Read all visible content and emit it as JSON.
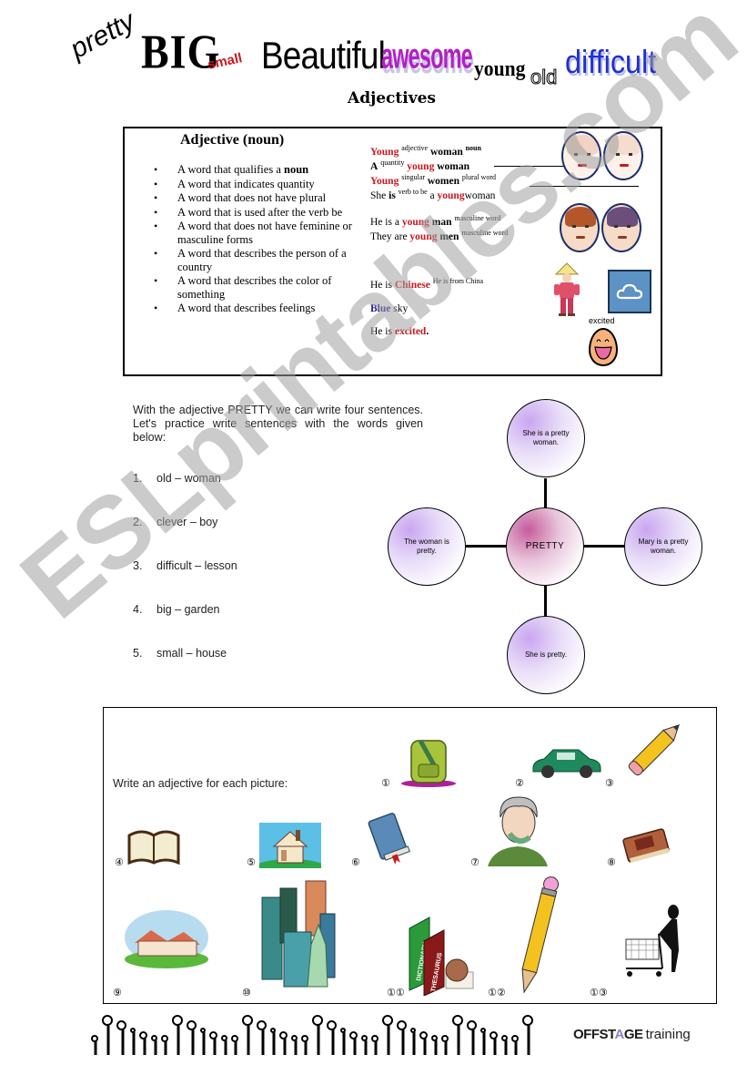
{
  "header": {
    "wordart": [
      "pretty",
      "BIG",
      "small",
      "Beautiful",
      "awesome",
      "young",
      "old",
      "difficult"
    ],
    "title": "Adjectives"
  },
  "definition_box": {
    "title": "Adjective (noun)",
    "bullets": [
      {
        "text": "A word that qualifies a ",
        "bold": "noun"
      },
      {
        "text": "A word that indicates quantity",
        "bold": ""
      },
      {
        "text": "A word that does not have plural",
        "bold": ""
      },
      {
        "text": "A word that is used after the verb be",
        "bold": ""
      },
      {
        "text": "A word that does not have feminine or masculine forms",
        "bold": ""
      },
      {
        "text": "A word that describes the person of a country",
        "bold": ""
      },
      {
        "text": "A word that describes the color of something",
        "bold": ""
      },
      {
        "text": "A word that describes feelings",
        "bold": ""
      }
    ],
    "examples": {
      "e1": {
        "a": "Young",
        "a_sup": "adjective",
        "b": "woman",
        "b_sup": "noun"
      },
      "e2": {
        "a": "A",
        "a_sup": "quantity",
        "b": "young",
        "c": "woman"
      },
      "e3": {
        "a": "Young",
        "a_sup": "singular",
        "b": "women",
        "b_sup": "plural word"
      },
      "e4": {
        "a": "She",
        "b": "is",
        "b_sup": "verb to be",
        "c": "a",
        "d": "young",
        "e": "woman"
      },
      "e5": {
        "a": "He is a",
        "b": "young",
        "c": "man",
        "c_sup": "masculine word"
      },
      "e6": {
        "a": "They are",
        "b": "young",
        "c": "men",
        "c_sup": "masculine word"
      },
      "e7": {
        "a": "He is",
        "b": "Chinese",
        "b_sup": "He is from China"
      },
      "e8": {
        "a": "Blue",
        "b": "sky"
      },
      "e9": {
        "a": "He is",
        "b": "excited",
        "c": "."
      }
    },
    "excited_label": "excited"
  },
  "practice": {
    "intro": "With the adjective PRETTY we can write four sentences. Let's practice write sentences with the words given below:",
    "items": [
      {
        "num": "1.",
        "text": "old – woman"
      },
      {
        "num": "2.",
        "text": "clever – boy"
      },
      {
        "num": "3.",
        "text": "difficult – lesson"
      },
      {
        "num": "4.",
        "text": "big – garden"
      },
      {
        "num": "5.",
        "text": "small – house"
      }
    ],
    "mind_map": {
      "center": "PRETTY",
      "top": "She is a pretty woman.",
      "left": "The woman is pretty.",
      "right": "Mary is a pretty woman.",
      "bottom": "She is pretty."
    }
  },
  "pictures": {
    "instruction": "Write an adjective for each picture:",
    "items": [
      {
        "num": "①",
        "subject": "backpack"
      },
      {
        "num": "②",
        "subject": "car"
      },
      {
        "num": "③",
        "subject": "pencil"
      },
      {
        "num": "④",
        "subject": "open-book"
      },
      {
        "num": "⑤",
        "subject": "house"
      },
      {
        "num": "⑥",
        "subject": "closed-book"
      },
      {
        "num": "⑦",
        "subject": "old-man-on-phone"
      },
      {
        "num": "⑧",
        "subject": "old-book"
      },
      {
        "num": "⑨",
        "subject": "big-house"
      },
      {
        "num": "⑩",
        "subject": "tall-buildings"
      },
      {
        "num": "①①",
        "subject": "dictionary-thesaurus"
      },
      {
        "num": "①②",
        "subject": "long-pencil"
      },
      {
        "num": "①③",
        "subject": "shopping-cart"
      }
    ],
    "book_labels": {
      "green": "DICTIONARY",
      "red": "THESAURUS"
    }
  },
  "footer": {
    "brand_a": "OFFST",
    "brand_b": "A",
    "brand_c": "GE",
    "brand_d": "training"
  },
  "watermark": "ESLprintables.com",
  "colors": {
    "accent_red": "#c8181e",
    "accent_blue": "#1a1a8c",
    "awesome_purple": "#b21fc6",
    "difficult_blue": "#1f2fd0"
  }
}
